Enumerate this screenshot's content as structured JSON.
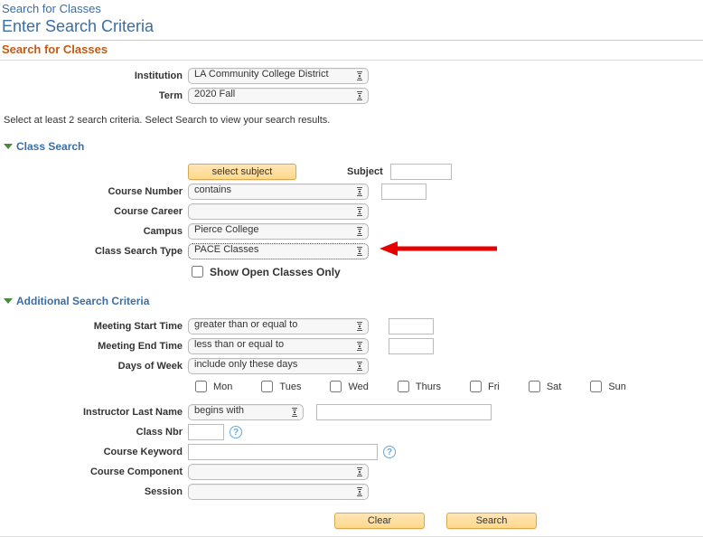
{
  "top_link": "Search for Classes",
  "page_title": "Enter Search Criteria",
  "sub_title": "Search for Classes",
  "hint": "Select at least 2 search criteria. Select Search to view your search results.",
  "hdr": {
    "institution_label": "Institution",
    "institution_value": "LA Community College District",
    "term_label": "Term",
    "term_value": "2020 Fall"
  },
  "sections": {
    "class_search": "Class Search",
    "additional": "Additional Search Criteria"
  },
  "class_search": {
    "select_subject_btn": "select subject",
    "subject_label": "Subject",
    "subject_value": "",
    "course_number_label": "Course Number",
    "course_number_op": "contains",
    "course_number_value": "",
    "course_career_label": "Course Career",
    "course_career_value": "",
    "campus_label": "Campus",
    "campus_value": "Pierce College",
    "class_search_type_label": "Class Search Type",
    "class_search_type_value": "PACE Classes",
    "open_only_label": "Show Open Classes Only",
    "open_only_checked": false
  },
  "additional": {
    "meeting_start_label": "Meeting Start Time",
    "meeting_start_op": "greater than or equal to",
    "meeting_start_value": "",
    "meeting_end_label": "Meeting End Time",
    "meeting_end_op": "less than or equal to",
    "meeting_end_value": "",
    "days_of_week_label": "Days of Week",
    "days_of_week_value": "include only these days",
    "days": {
      "mon": "Mon",
      "tues": "Tues",
      "wed": "Wed",
      "thurs": "Thurs",
      "fri": "Fri",
      "sat": "Sat",
      "sun": "Sun"
    },
    "instructor_last_name_label": "Instructor Last Name",
    "instructor_last_name_op": "begins with",
    "instructor_last_name_value": "",
    "class_nbr_label": "Class Nbr",
    "class_nbr_value": "",
    "course_keyword_label": "Course Keyword",
    "course_keyword_value": "",
    "course_component_label": "Course Component",
    "course_component_value": "",
    "session_label": "Session",
    "session_value": ""
  },
  "buttons": {
    "clear": "Clear",
    "search": "Search"
  }
}
